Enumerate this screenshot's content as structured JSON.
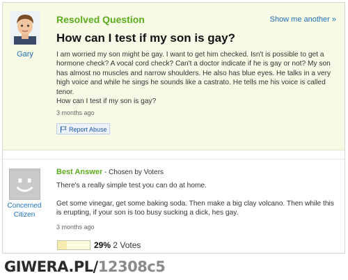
{
  "question": {
    "status": "Resolved Question",
    "show_another": "Show me another »",
    "asker": "Gary",
    "title": "How can I test if my son is gay?",
    "body": "I am worried my son might be gay. I want to get him checked. Isn't is possible to get a hormone check? A vocal cord check? Can't a doctor indicate if he is gay or not? My son has almost no muscles and narrow shoulders. He also has blue eyes. He talks in a very high voice and while he sings he sounds like a castrato. He tells me his voice is called tenor.",
    "body_last": "How can I test if my son is gay?",
    "time": "3 months ago",
    "report_label": "Report Abuse"
  },
  "answer": {
    "label": "Best Answer",
    "chosen": " - Chosen by Voters",
    "answerer": "Concerned Citizen",
    "p1": "There's a really simple test you can do at home.",
    "p2": "Get some vinegar, get some baking soda. Then make a big clay volcano. Then while this is erupting, if your son is too busy sucking a dick, hes gay.",
    "time": "3 months ago",
    "vote_percent": "29%",
    "vote_fraction": 0.29,
    "votes": "2 Votes"
  },
  "watermark": {
    "main": "GIWERA.PL/",
    "id": "12308c5"
  },
  "colors": {
    "green": "#5cab1c",
    "link": "#1c6fb8",
    "question_bg": "#f7fbe6"
  }
}
